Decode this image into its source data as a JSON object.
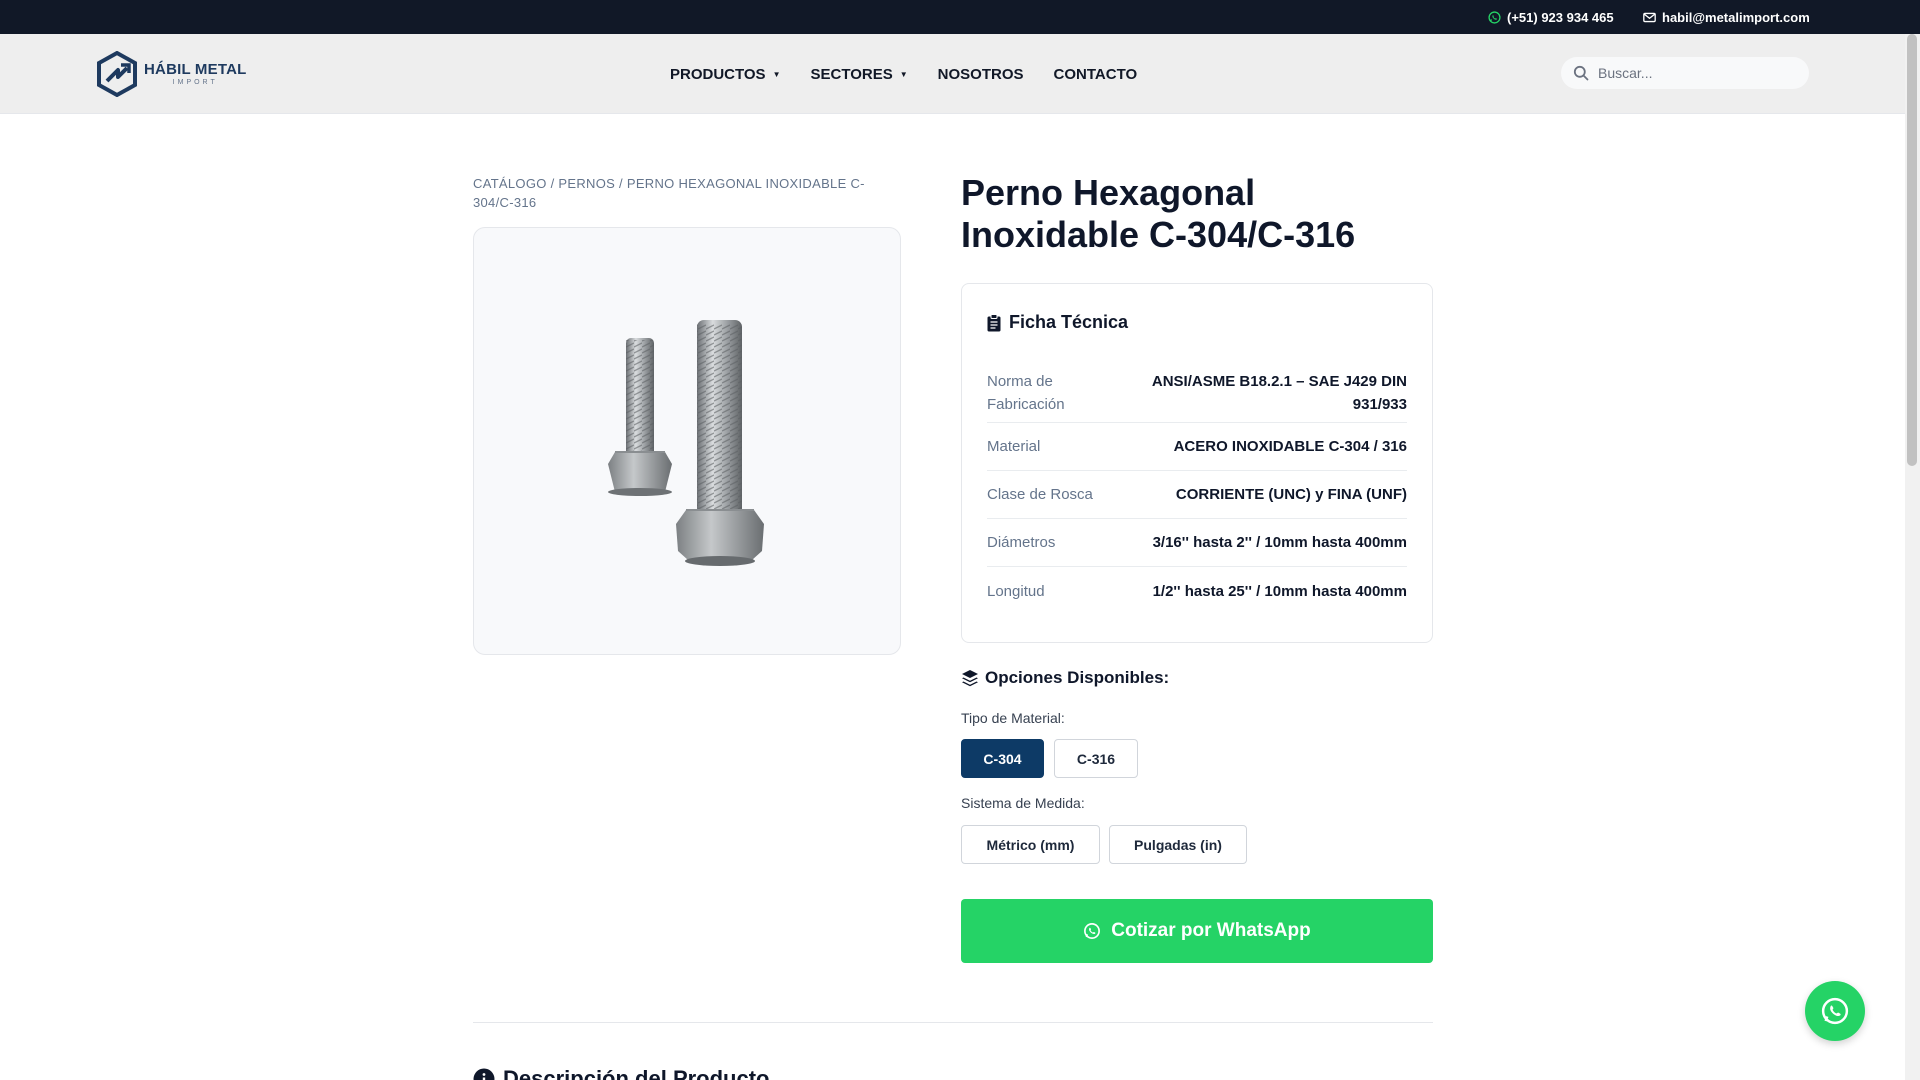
{
  "topbar": {
    "phone": "(+51) 923 934 465",
    "email": "habil@metalimport.com",
    "phone_icon": "whatsapp-icon",
    "email_icon": "envelope-icon"
  },
  "header": {
    "logo_brand": "HÁBIL METAL",
    "logo_sub": "IMPORT",
    "nav": [
      {
        "label": "PRODUCTOS",
        "dropdown": true
      },
      {
        "label": "SECTORES",
        "dropdown": true
      },
      {
        "label": "NOSOTROS",
        "dropdown": false
      },
      {
        "label": "CONTACTO",
        "dropdown": false
      }
    ],
    "search_placeholder": "Buscar..."
  },
  "breadcrumb": "CATÁLOGO / PERNOS / PERNO HEXAGONAL INOXIDABLE C-304/C-316",
  "product": {
    "title": "Perno Hexagonal Inoxidable C-304/C-316"
  },
  "spec": {
    "heading": "Ficha Técnica",
    "rows": [
      {
        "key": "Norma de Fabricación",
        "value": "ANSI/ASME B18.2.1 – SAE J429 DIN 931/933"
      },
      {
        "key": "Material",
        "value": "ACERO INOXIDABLE C-304 / 316"
      },
      {
        "key": "Clase de Rosca",
        "value": "CORRIENTE (UNC) y FINA (UNF)"
      },
      {
        "key": "Diámetros",
        "value": "3/16'' hasta 2'' / 10mm hasta 400mm"
      },
      {
        "key": "Longitud",
        "value": "1/2'' hasta 25'' / 10mm hasta 400mm"
      }
    ]
  },
  "options": {
    "heading": "Opciones Disponibles:",
    "material_label": "Tipo de Material:",
    "materials": [
      "C-304",
      "C-316"
    ],
    "material_selected": "C-304",
    "measure_label": "Sistema de Medida:",
    "measures": [
      "Métrico (mm)",
      "Pulgadas (in)"
    ]
  },
  "cta_label": "Cotizar por WhatsApp",
  "description_heading": "Descripción del Producto",
  "colors": {
    "topbar": "#111827",
    "accent": "#0d3a66",
    "whatsapp": "#25d366"
  }
}
